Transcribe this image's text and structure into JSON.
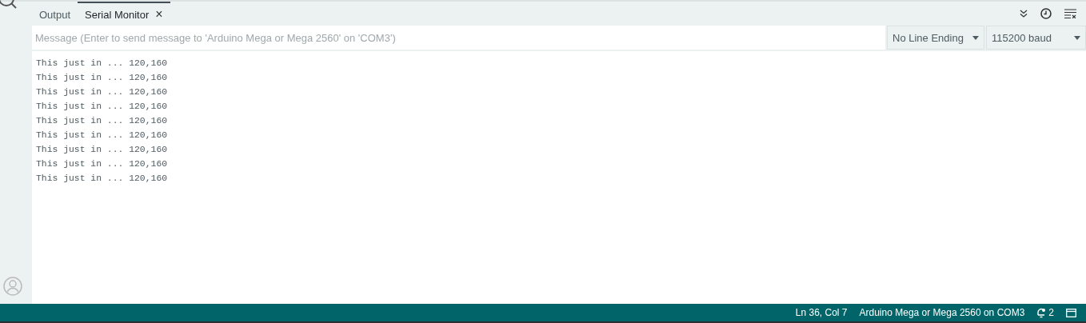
{
  "tabs": [
    {
      "label": "Output",
      "selected": false,
      "closable": false
    },
    {
      "label": "Serial Monitor",
      "selected": true,
      "closable": true
    }
  ],
  "close_glyph": "×",
  "message": {
    "placeholder": "Message (Enter to send message to 'Arduino Mega or Mega 2560' on 'COM3')"
  },
  "line_ending": {
    "value": "No Line Ending"
  },
  "baud": {
    "value": "115200 baud"
  },
  "output_lines": [
    "This just in ... 120,160",
    "This just in ... 120,160",
    "This just in ... 120,160",
    "This just in ... 120,160",
    "This just in ... 120,160",
    "This just in ... 120,160",
    "This just in ... 120,160",
    "This just in ... 120,160",
    "This just in ... 120,160"
  ],
  "status_bar": {
    "position": "Ln 36, Col 7",
    "board": "Arduino Mega or Mega 2560 on COM3",
    "notifications": "2"
  }
}
